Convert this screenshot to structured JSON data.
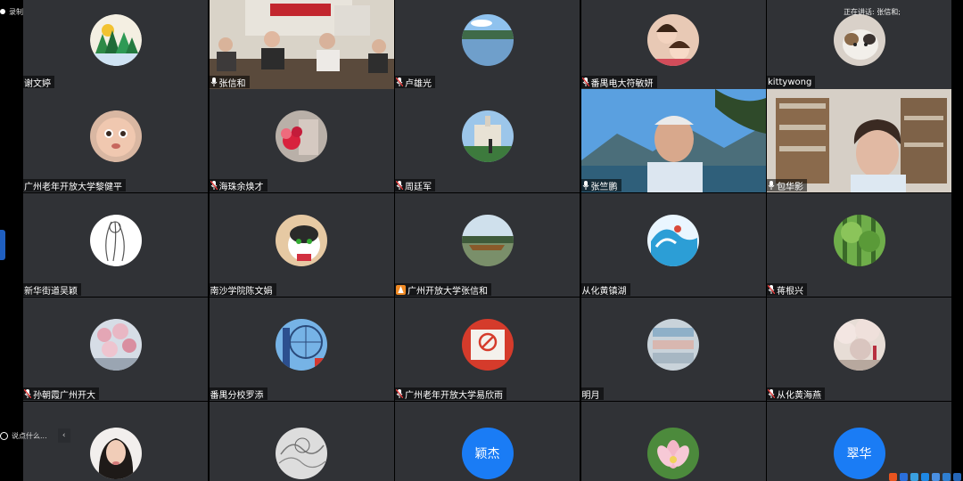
{
  "recording": {
    "label": "录制中"
  },
  "speaking": {
    "label": "正在讲话: 张信和;"
  },
  "chat": {
    "placeholder": "说点什么..."
  },
  "participants": [
    {
      "name": "谢文婷",
      "mic": false,
      "kind": "avatar",
      "avatar": "trees"
    },
    {
      "name": "张信和",
      "mic": true,
      "kind": "video",
      "video": "meeting-room",
      "active": true
    },
    {
      "name": "卢雄光",
      "mic": "muted",
      "kind": "avatar",
      "avatar": "lake"
    },
    {
      "name": "番禺电大符敏妍",
      "mic": "muted",
      "kind": "avatar",
      "avatar": "kids"
    },
    {
      "name": "kittywong",
      "mic": false,
      "kind": "avatar",
      "avatar": "cat"
    },
    {
      "name": "广州老年开放大学黎健平",
      "mic": false,
      "kind": "avatar",
      "avatar": "baby"
    },
    {
      "name": "海珠余焕才",
      "mic": "muted",
      "kind": "avatar",
      "avatar": "flowers"
    },
    {
      "name": "周廷军",
      "mic": "muted",
      "kind": "avatar",
      "avatar": "building"
    },
    {
      "name": "张竺鹏",
      "mic": true,
      "kind": "video",
      "video": "mountain-man"
    },
    {
      "name": "包华影",
      "mic": true,
      "kind": "video",
      "video": "bookshelf-woman"
    },
    {
      "name": "新华街道吴颖",
      "mic": false,
      "kind": "avatar",
      "avatar": "sketch"
    },
    {
      "name": "南沙学院陈文娟",
      "mic": false,
      "kind": "avatar",
      "avatar": "cat2"
    },
    {
      "name": "广州开放大学张信和",
      "mic": "host",
      "kind": "avatar",
      "avatar": "boat"
    },
    {
      "name": "从化黄镇湖",
      "mic": false,
      "kind": "avatar",
      "avatar": "surf"
    },
    {
      "name": "蒋根兴",
      "mic": "muted",
      "kind": "avatar",
      "avatar": "forest"
    },
    {
      "name": "孙朝霞广州开大",
      "mic": "muted",
      "kind": "avatar",
      "avatar": "blossom"
    },
    {
      "name": "番禺分校罗添",
      "mic": false,
      "kind": "avatar",
      "avatar": "ferris"
    },
    {
      "name": "广州老年开放大学易欣雨",
      "mic": "muted",
      "kind": "avatar",
      "avatar": "sign"
    },
    {
      "name": "明月",
      "mic": false,
      "kind": "avatar",
      "avatar": "mall"
    },
    {
      "name": "从化黄海燕",
      "mic": "muted",
      "kind": "avatar",
      "avatar": "cherry"
    },
    {
      "name": "",
      "mic": false,
      "kind": "avatar",
      "avatar": "girl"
    },
    {
      "name": "",
      "mic": false,
      "kind": "avatar",
      "avatar": "pencil"
    },
    {
      "name": "",
      "mic": false,
      "kind": "text",
      "text": "颖杰"
    },
    {
      "name": "",
      "mic": false,
      "kind": "avatar",
      "avatar": "lotus"
    },
    {
      "name": "",
      "mic": false,
      "kind": "text",
      "text": "翠华"
    }
  ],
  "colors": {
    "tile": "#303236",
    "active_border": "#1fae4a",
    "text_avatar": "#1a7cf5",
    "host_badge": "#f08a24"
  }
}
